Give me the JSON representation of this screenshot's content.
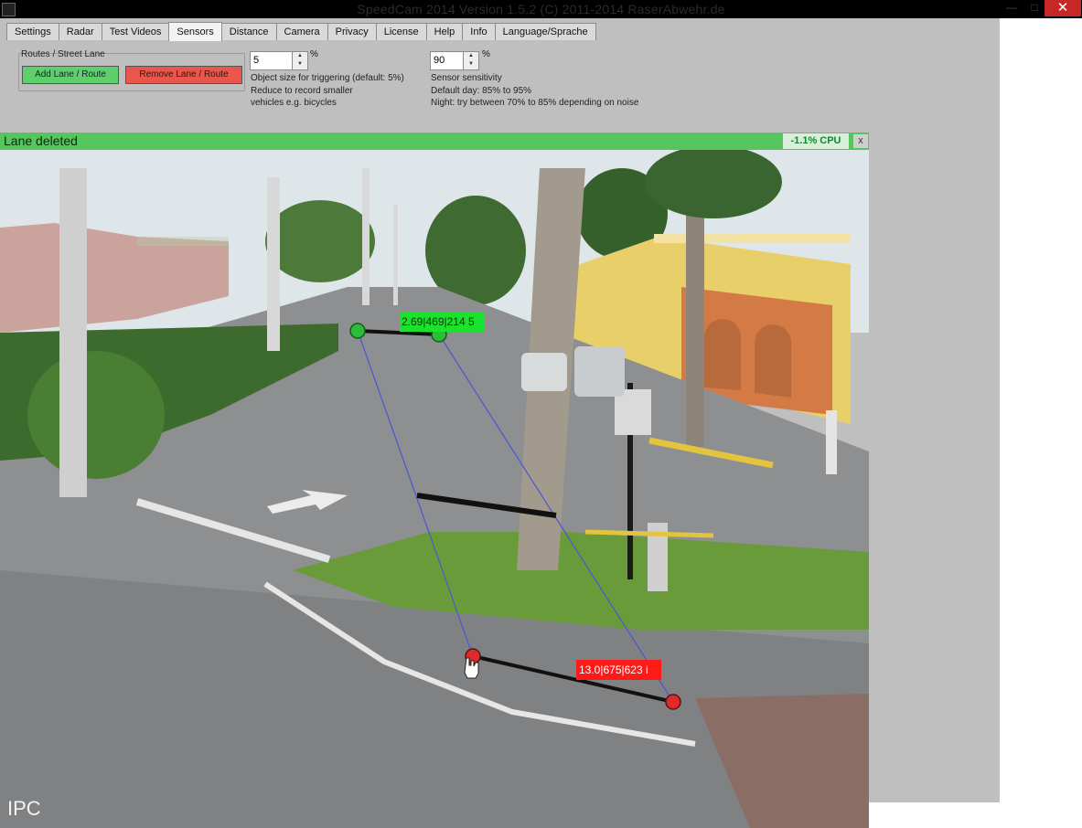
{
  "window": {
    "title": "SpeedCam 2014 Version 1.5.2 (C) 2011-2014 RaserAbwehr.de",
    "controls": {
      "minimize": "—",
      "maximize": "□",
      "close": "✕"
    }
  },
  "tabs": [
    {
      "label": "Settings"
    },
    {
      "label": "Radar"
    },
    {
      "label": "Test Videos"
    },
    {
      "label": "Sensors",
      "active": true
    },
    {
      "label": "Distance"
    },
    {
      "label": "Camera"
    },
    {
      "label": "Privacy"
    },
    {
      "label": "License"
    },
    {
      "label": "Help"
    },
    {
      "label": "Info"
    },
    {
      "label": "Language/Sprache"
    }
  ],
  "routes": {
    "group_label": "Routes / Street Lane",
    "add_label": "Add Lane / Route",
    "remove_label": "Remove Lane / Route"
  },
  "object_size": {
    "value": "5",
    "unit": "%",
    "help": [
      "Object size for triggering (default: 5%)",
      "Reduce to record smaller",
      "vehicles e.g. bicycles"
    ]
  },
  "sensitivity": {
    "value": "90",
    "unit": "%",
    "help": [
      "Sensor sensitivity",
      "Default day: 85% to 95%",
      "Night: try between 70% to 85% depending on noise"
    ]
  },
  "status": {
    "message": "Lane deleted",
    "cpu": "-1.1% CPU",
    "close": "x"
  },
  "camera": {
    "label": "IPC",
    "green_marker": "2.69|469|214 5",
    "red_marker": "13.0|675|623 i"
  },
  "colors": {
    "status_green": "#57c55e",
    "add_button": "#5fcf6c",
    "remove_button": "#e9564c",
    "window_gray": "#c0bfc0"
  }
}
